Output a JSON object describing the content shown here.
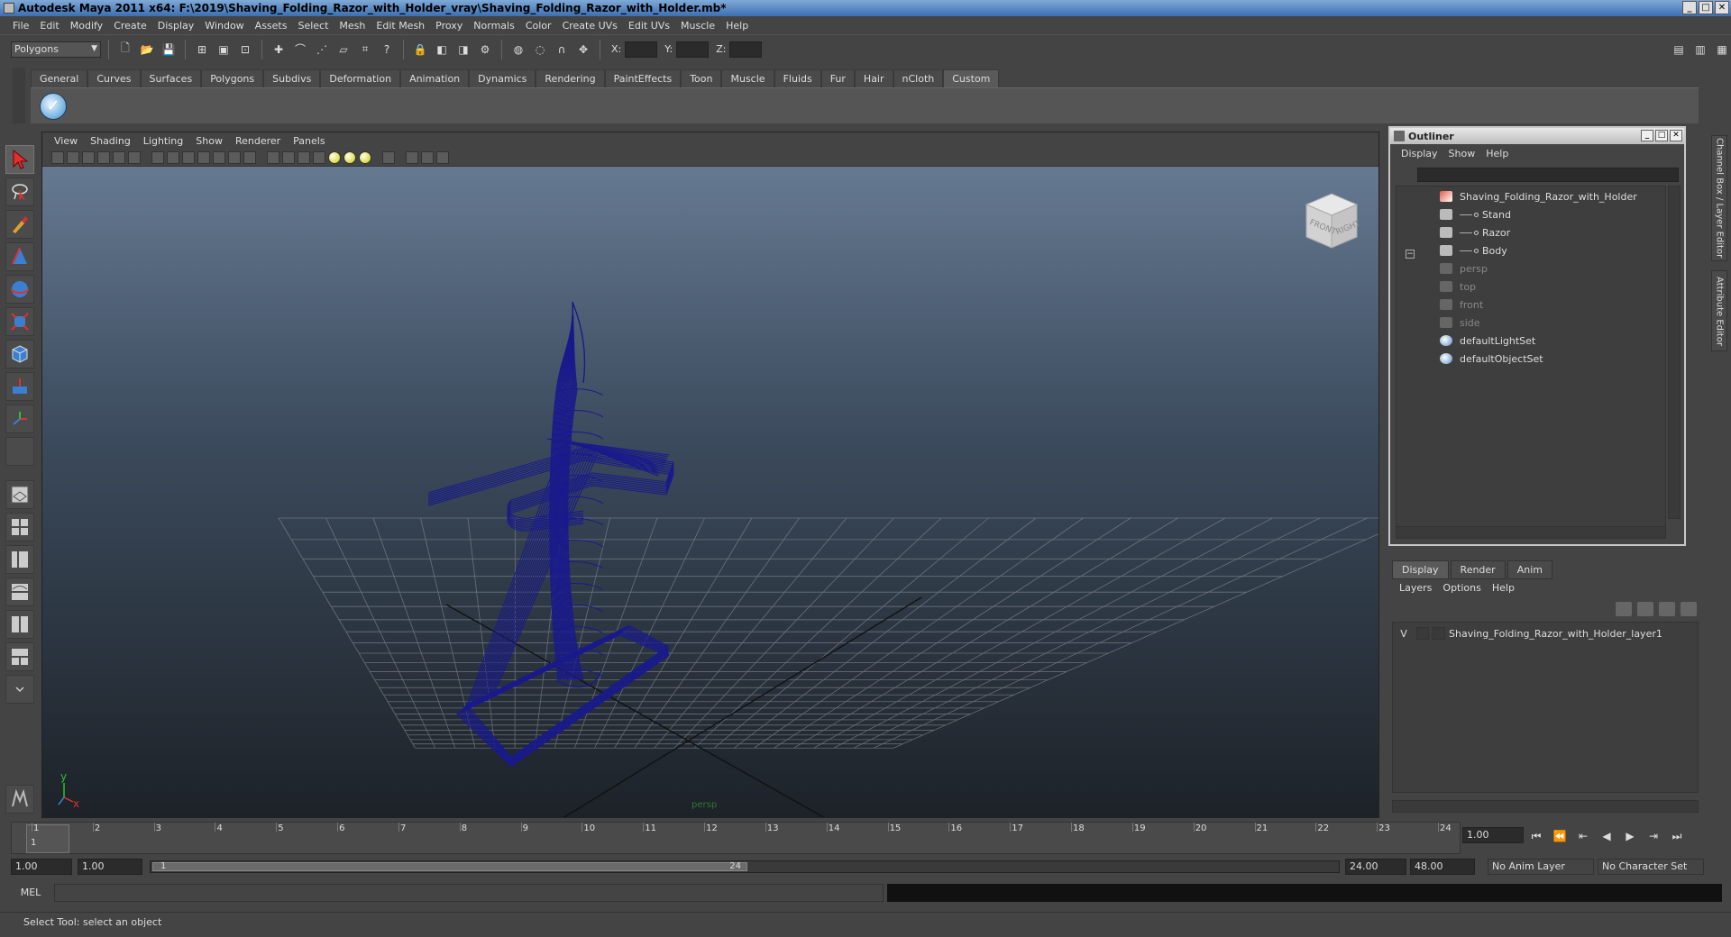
{
  "window": {
    "title": "Autodesk Maya 2011 x64: F:\\2019\\Shaving_Folding_Razor_with_Holder_vray\\Shaving_Folding_Razor_with_Holder.mb*",
    "min": "_",
    "max": "□",
    "close": "✕"
  },
  "menubar": [
    "File",
    "Edit",
    "Modify",
    "Create",
    "Display",
    "Window",
    "Assets",
    "Select",
    "Mesh",
    "Edit Mesh",
    "Proxy",
    "Normals",
    "Color",
    "Create UVs",
    "Edit UVs",
    "Muscle",
    "Help"
  ],
  "statusline": {
    "mode": "Polygons",
    "x_label": "X:",
    "y_label": "Y:",
    "z_label": "Z:"
  },
  "shelf": {
    "tabs": [
      "General",
      "Curves",
      "Surfaces",
      "Polygons",
      "Subdivs",
      "Deformation",
      "Animation",
      "Dynamics",
      "Rendering",
      "PaintEffects",
      "Toon",
      "Muscle",
      "Fluids",
      "Fur",
      "Hair",
      "nCloth",
      "Custom"
    ],
    "active_tab": "Custom"
  },
  "viewport": {
    "menu": [
      "View",
      "Shading",
      "Lighting",
      "Show",
      "Renderer",
      "Panels"
    ],
    "camera_label": "persp",
    "viewcube_front": "FRONT",
    "viewcube_right": "RIGHT",
    "axis_x": "x",
    "axis_y": "y",
    "wire_color": "#1a1a8c"
  },
  "outliner": {
    "title": "Outliner",
    "menu": [
      "Display",
      "Show",
      "Help"
    ],
    "items": [
      {
        "label": "Shaving_Folding_Razor_with_Holder",
        "kind": "group",
        "level": 0
      },
      {
        "label": "Stand",
        "kind": "mesh",
        "level": 1
      },
      {
        "label": "Razor",
        "kind": "mesh",
        "level": 1
      },
      {
        "label": "Body",
        "kind": "mesh",
        "level": 1
      },
      {
        "label": "persp",
        "kind": "camera",
        "level": 0,
        "dim": true
      },
      {
        "label": "top",
        "kind": "camera",
        "level": 0,
        "dim": true
      },
      {
        "label": "front",
        "kind": "camera",
        "level": 0,
        "dim": true
      },
      {
        "label": "side",
        "kind": "camera",
        "level": 0,
        "dim": true
      },
      {
        "label": "defaultLightSet",
        "kind": "set",
        "level": 0
      },
      {
        "label": "defaultObjectSet",
        "kind": "set",
        "level": 0
      }
    ],
    "expander": "−"
  },
  "sidetabs": [
    "Channel Box / Layer Editor",
    "Attribute Editor"
  ],
  "layers": {
    "tabs": [
      "Display",
      "Render",
      "Anim"
    ],
    "active_tab": "Display",
    "menu": [
      "Layers",
      "Options",
      "Help"
    ],
    "rows": [
      {
        "visible": "V",
        "name": "Shaving_Folding_Razor_with_Holder_layer1"
      }
    ]
  },
  "timeline": {
    "ticks": [
      "1",
      "2",
      "3",
      "4",
      "5",
      "6",
      "7",
      "8",
      "9",
      "10",
      "11",
      "12",
      "13",
      "14",
      "15",
      "16",
      "17",
      "18",
      "19",
      "20",
      "21",
      "22",
      "23",
      "24"
    ],
    "current_frame_marker": "1",
    "current_frame": "1.00",
    "playback": [
      "⏮",
      "⏪",
      "⇤",
      "◀",
      "▶",
      "⇥",
      "⏭"
    ]
  },
  "range": {
    "start_time": "1.00",
    "playback_start": "1.00",
    "slider_min": "1",
    "slider_max": "24",
    "playback_end": "24.00",
    "end_time": "48.00",
    "anim_layer": "No Anim Layer",
    "character_set": "No Character Set"
  },
  "cmdline": {
    "label": "MEL"
  },
  "helpline": {
    "text": "Select Tool: select an object"
  }
}
